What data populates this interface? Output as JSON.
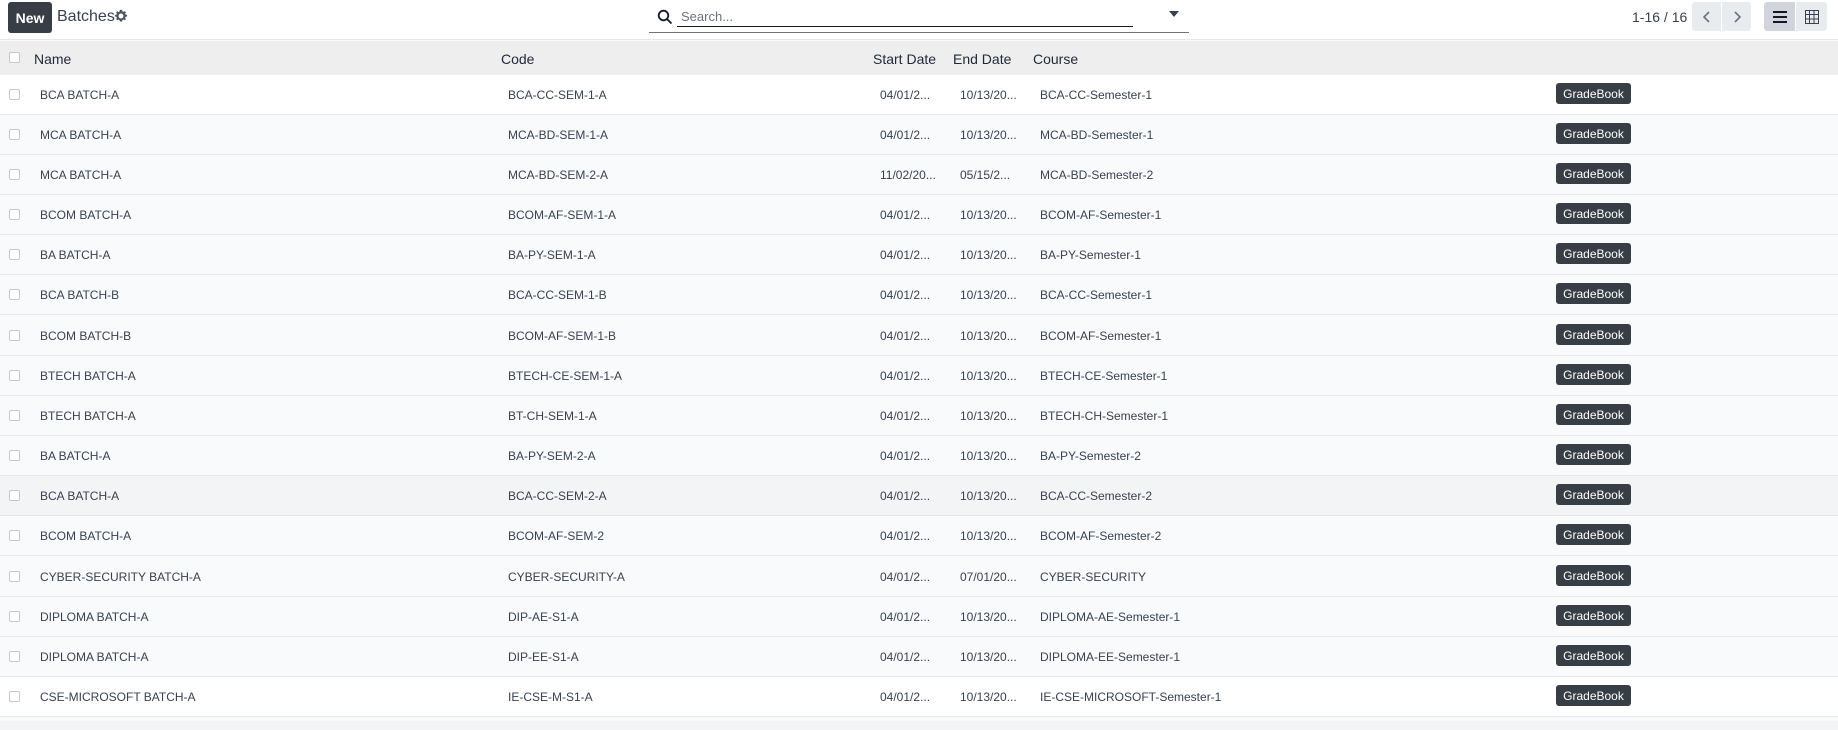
{
  "control_panel": {
    "new_label": "New",
    "breadcrumb": "Batches",
    "search_placeholder": "Search...",
    "pager": "1-16 / 16"
  },
  "icons": {
    "gear": "gear-icon",
    "search": "search-icon",
    "prev": "chevron-left-icon",
    "next": "chevron-right-icon",
    "list_view": "list-view-icon",
    "pivot_view": "pivot-view-icon"
  },
  "colors": {
    "dark_button": "#383e45",
    "header_bg": "#eeeeee"
  },
  "table": {
    "columns": [
      "Name",
      "Code",
      "Start Date",
      "End Date",
      "Course"
    ],
    "action_label": "GradeBook",
    "rows": [
      {
        "name": "BCA BATCH-A",
        "code": "BCA-CC-SEM-1-A",
        "start": "04/01/2...",
        "end": "10/13/20...",
        "course": "BCA-CC-Semester-1"
      },
      {
        "name": "MCA BATCH-A",
        "code": "MCA-BD-SEM-1-A",
        "start": "04/01/2...",
        "end": "10/13/20...",
        "course": "MCA-BD-Semester-1"
      },
      {
        "name": "MCA BATCH-A",
        "code": "MCA-BD-SEM-2-A",
        "start": "11/02/20...",
        "end": "05/15/2...",
        "course": "MCA-BD-Semester-2"
      },
      {
        "name": "BCOM BATCH-A",
        "code": "BCOM-AF-SEM-1-A",
        "start": "04/01/2...",
        "end": "10/13/20...",
        "course": "BCOM-AF-Semester-1"
      },
      {
        "name": "BA BATCH-A",
        "code": "BA-PY-SEM-1-A",
        "start": "04/01/2...",
        "end": "10/13/20...",
        "course": "BA-PY-Semester-1"
      },
      {
        "name": "BCA BATCH-B",
        "code": "BCA-CC-SEM-1-B",
        "start": "04/01/2...",
        "end": "10/13/20...",
        "course": "BCA-CC-Semester-1"
      },
      {
        "name": "BCOM BATCH-B",
        "code": "BCOM-AF-SEM-1-B",
        "start": "04/01/2...",
        "end": "10/13/20...",
        "course": "BCOM-AF-Semester-1"
      },
      {
        "name": "BTECH BATCH-A",
        "code": "BTECH-CE-SEM-1-A",
        "start": "04/01/2...",
        "end": "10/13/20...",
        "course": "BTECH-CE-Semester-1"
      },
      {
        "name": "BTECH BATCH-A",
        "code": "BT-CH-SEM-1-A",
        "start": "04/01/2...",
        "end": "10/13/20...",
        "course": "BTECH-CH-Semester-1"
      },
      {
        "name": "BA BATCH-A",
        "code": "BA-PY-SEM-2-A",
        "start": "04/01/2...",
        "end": "10/13/20...",
        "course": "BA-PY-Semester-2"
      },
      {
        "name": "BCA BATCH-A",
        "code": "BCA-CC-SEM-2-A",
        "start": "04/01/2...",
        "end": "10/13/20...",
        "course": "BCA-CC-Semester-2"
      },
      {
        "name": "BCOM BATCH-A",
        "code": "BCOM-AF-SEM-2",
        "start": "04/01/2...",
        "end": "10/13/20...",
        "course": "BCOM-AF-Semester-2"
      },
      {
        "name": "CYBER-SECURITY BATCH-A",
        "code": "CYBER-SECURITY-A",
        "start": "04/01/2...",
        "end": "07/01/20...",
        "course": "CYBER-SECURITY"
      },
      {
        "name": "DIPLOMA BATCH-A",
        "code": "DIP-AE-S1-A",
        "start": "04/01/2...",
        "end": "10/13/20...",
        "course": "DIPLOMA-AE-Semester-1"
      },
      {
        "name": "DIPLOMA BATCH-A",
        "code": "DIP-EE-S1-A",
        "start": "04/01/2...",
        "end": "10/13/20...",
        "course": "DIPLOMA-EE-Semester-1"
      },
      {
        "name": "CSE-MICROSOFT BATCH-A",
        "code": "IE-CSE-M-S1-A",
        "start": "04/01/2...",
        "end": "10/13/20...",
        "course": "IE-CSE-MICROSOFT-Semester-1"
      }
    ]
  }
}
